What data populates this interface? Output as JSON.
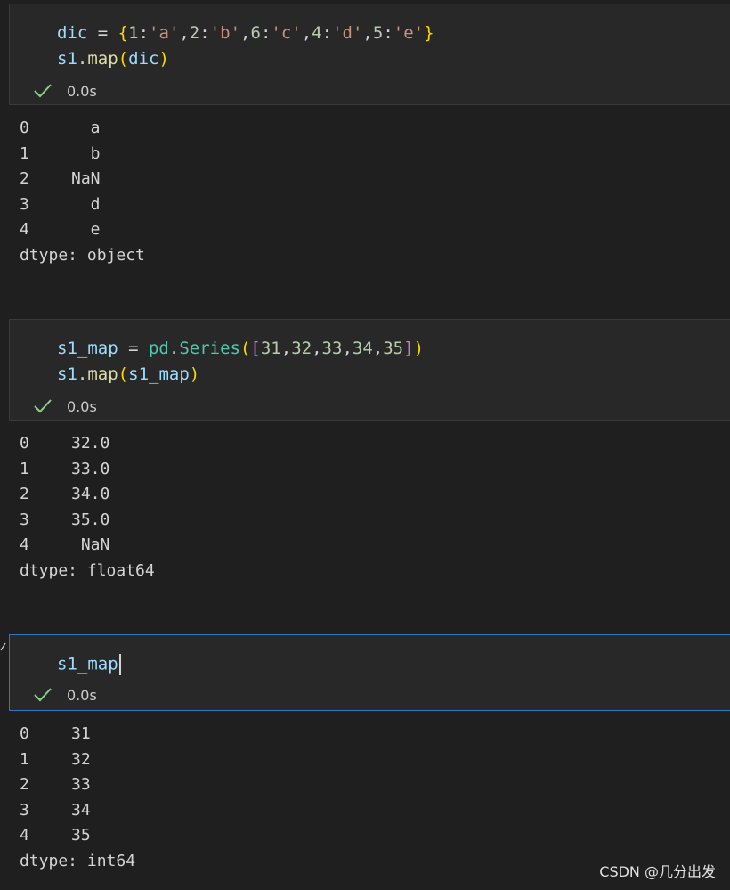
{
  "cells": [
    {
      "code": [
        {
          "tokens": [
            {
              "t": "dic",
              "c": "k"
            },
            {
              "t": " = ",
              "c": "op"
            },
            {
              "t": "{",
              "c": "b1"
            },
            {
              "t": "1",
              "c": "n"
            },
            {
              "t": ":",
              "c": "p"
            },
            {
              "t": "'a'",
              "c": "s"
            },
            {
              "t": ",",
              "c": "p"
            },
            {
              "t": "2",
              "c": "n"
            },
            {
              "t": ":",
              "c": "p"
            },
            {
              "t": "'b'",
              "c": "s"
            },
            {
              "t": ",",
              "c": "p"
            },
            {
              "t": "6",
              "c": "n"
            },
            {
              "t": ":",
              "c": "p"
            },
            {
              "t": "'c'",
              "c": "s"
            },
            {
              "t": ",",
              "c": "p"
            },
            {
              "t": "4",
              "c": "n"
            },
            {
              "t": ":",
              "c": "p"
            },
            {
              "t": "'d'",
              "c": "s"
            },
            {
              "t": ",",
              "c": "p"
            },
            {
              "t": "5",
              "c": "n"
            },
            {
              "t": ":",
              "c": "p"
            },
            {
              "t": "'e'",
              "c": "s"
            },
            {
              "t": "}",
              "c": "b1"
            }
          ]
        },
        {
          "tokens": [
            {
              "t": "s1",
              "c": "k"
            },
            {
              "t": ".",
              "c": "p"
            },
            {
              "t": "map",
              "c": "f"
            },
            {
              "t": "(",
              "c": "b1"
            },
            {
              "t": "dic",
              "c": "k"
            },
            {
              "t": ")",
              "c": "b1"
            }
          ]
        }
      ],
      "status": "0.0s",
      "output": {
        "rows": [
          {
            "index": "0",
            "value": "  a"
          },
          {
            "index": "1",
            "value": "  b"
          },
          {
            "index": "2",
            "value": "NaN"
          },
          {
            "index": "3",
            "value": "  d"
          },
          {
            "index": "4",
            "value": "  e"
          }
        ],
        "dtype": "dtype: object"
      }
    },
    {
      "code": [
        {
          "tokens": [
            {
              "t": "s1_map",
              "c": "k"
            },
            {
              "t": " = ",
              "c": "op"
            },
            {
              "t": "pd",
              "c": "cls"
            },
            {
              "t": ".",
              "c": "p"
            },
            {
              "t": "Series",
              "c": "cls"
            },
            {
              "t": "(",
              "c": "b1"
            },
            {
              "t": "[",
              "c": "b2"
            },
            {
              "t": "31",
              "c": "n"
            },
            {
              "t": ",",
              "c": "p"
            },
            {
              "t": "32",
              "c": "n"
            },
            {
              "t": ",",
              "c": "p"
            },
            {
              "t": "33",
              "c": "n"
            },
            {
              "t": ",",
              "c": "p"
            },
            {
              "t": "34",
              "c": "n"
            },
            {
              "t": ",",
              "c": "p"
            },
            {
              "t": "35",
              "c": "n"
            },
            {
              "t": "]",
              "c": "b2"
            },
            {
              "t": ")",
              "c": "b1"
            }
          ]
        },
        {
          "tokens": [
            {
              "t": "s1",
              "c": "k"
            },
            {
              "t": ".",
              "c": "p"
            },
            {
              "t": "map",
              "c": "f"
            },
            {
              "t": "(",
              "c": "b1"
            },
            {
              "t": "s1_map",
              "c": "k"
            },
            {
              "t": ")",
              "c": "b1"
            }
          ]
        }
      ],
      "status": "0.0s",
      "output": {
        "rows": [
          {
            "index": "0",
            "value": "32.0"
          },
          {
            "index": "1",
            "value": "33.0"
          },
          {
            "index": "2",
            "value": "34.0"
          },
          {
            "index": "3",
            "value": "35.0"
          },
          {
            "index": "4",
            "value": " NaN"
          }
        ],
        "dtype": "dtype: float64"
      }
    },
    {
      "code": [
        {
          "tokens": [
            {
              "t": "s1_map",
              "c": "k"
            }
          ],
          "cursor": true
        }
      ],
      "status": "0.0s",
      "output": {
        "rows": [
          {
            "index": "0",
            "value": "31"
          },
          {
            "index": "1",
            "value": "32"
          },
          {
            "index": "2",
            "value": "33"
          },
          {
            "index": "3",
            "value": "34"
          },
          {
            "index": "4",
            "value": "35"
          }
        ],
        "dtype": "dtype: int64"
      }
    }
  ],
  "colors": {
    "check": "#89d185",
    "focus_border": "#2b79c2"
  },
  "icons": {
    "status": "check-icon"
  },
  "watermark": "CSDN @几分出发"
}
